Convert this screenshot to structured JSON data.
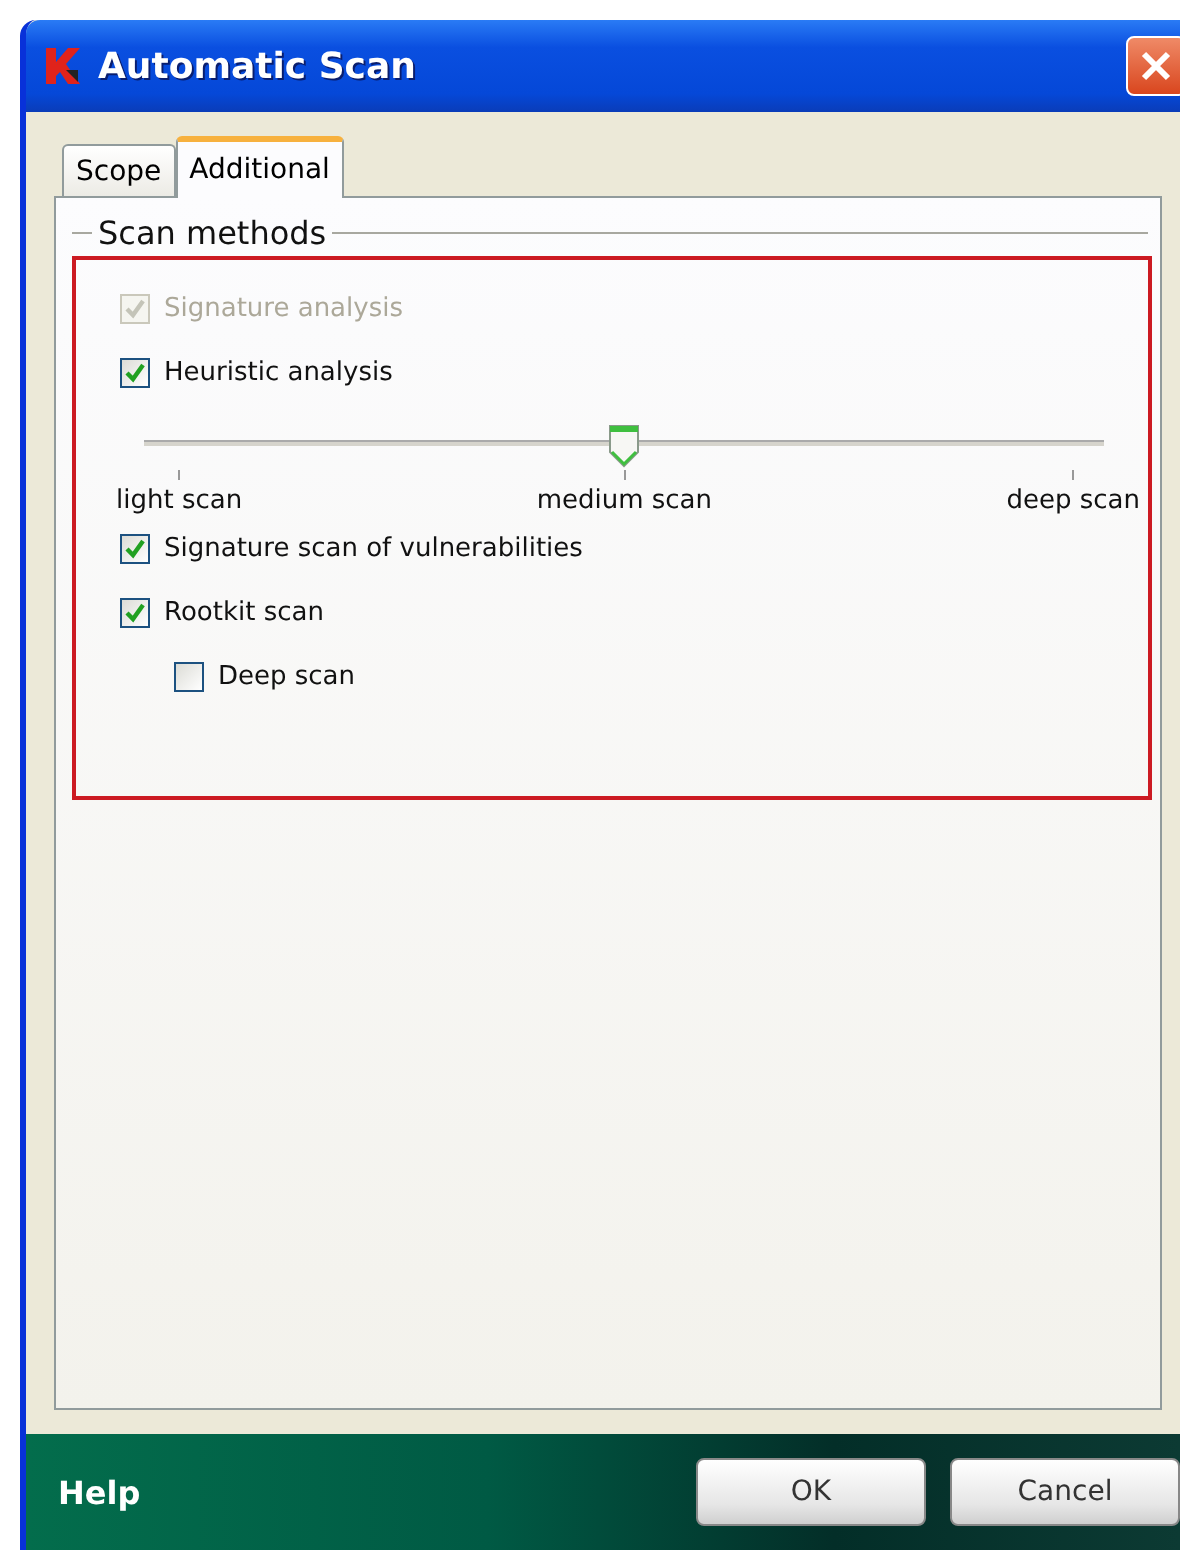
{
  "window": {
    "title": "Automatic Scan"
  },
  "tabs": [
    {
      "label": "Scope",
      "selected": false
    },
    {
      "label": "Additional",
      "selected": true
    }
  ],
  "group": {
    "title": "Scan methods"
  },
  "options": [
    {
      "kind": "checkbox",
      "label": "Signature analysis",
      "checked": true,
      "disabled": true
    },
    {
      "kind": "checkbox",
      "label": "Heuristic analysis",
      "checked": true,
      "disabled": false
    },
    {
      "kind": "slider",
      "level": 0.5,
      "labels": [
        "light scan",
        "medium scan",
        "deep scan"
      ]
    },
    {
      "kind": "checkbox",
      "label": "Signature scan of vulnerabilities",
      "checked": true,
      "disabled": false
    },
    {
      "kind": "checkbox",
      "label": "Rootkit scan",
      "checked": true,
      "disabled": false,
      "children": [
        {
          "kind": "checkbox",
          "label": "Deep scan",
          "checked": false,
          "disabled": false
        }
      ]
    }
  ],
  "footer": {
    "help": "Help",
    "buttons": [
      "OK",
      "Cancel"
    ]
  }
}
